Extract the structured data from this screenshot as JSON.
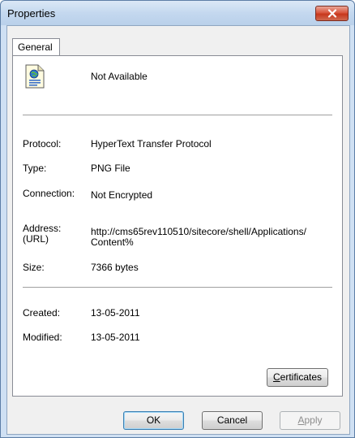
{
  "window": {
    "title": "Properties"
  },
  "tabs": [
    {
      "label": "General"
    }
  ],
  "general": {
    "name": "Not Available",
    "protocol_label": "Protocol:",
    "protocol_value": "HyperText Transfer Protocol",
    "type_label": "Type:",
    "type_value": "PNG File",
    "connection_label": "Connection:",
    "connection_value": "Not Encrypted",
    "address_label_1": "Address:",
    "address_label_2": "(URL)",
    "address_line_1": "http://cms65rev110510/sitecore/shell/Applications/",
    "address_line_2": "Content%",
    "size_label": "Size:",
    "size_value": "7366 bytes",
    "created_label": "Created:",
    "created_value": "13-05-2011",
    "modified_label": "Modified:",
    "modified_value": "13-05-2011",
    "certificates_first": "C",
    "certificates_rest": "ertificates"
  },
  "footer": {
    "ok_label": "OK",
    "cancel_label": "Cancel",
    "apply_first": "A",
    "apply_rest": "pply"
  },
  "icons": {
    "close": "close-icon",
    "file": "web-document-icon"
  }
}
